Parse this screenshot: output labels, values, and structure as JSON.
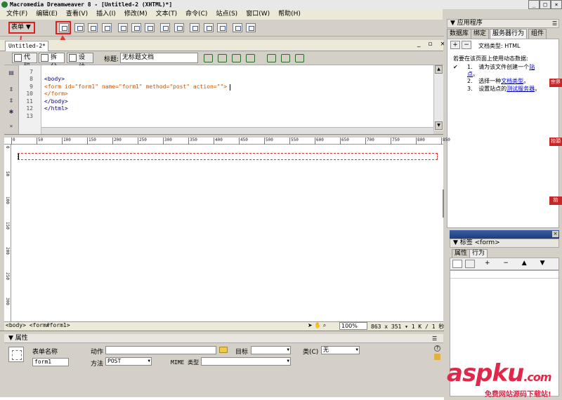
{
  "window": {
    "title": "Macromedia Dreamweaver 8 - [Untitled-2 (XHTML)*]",
    "controls": [
      "_",
      "□",
      "×"
    ]
  },
  "menubar": [
    "文件(F)",
    "编辑(E)",
    "查看(V)",
    "插入(I)",
    "修改(M)",
    "文本(T)",
    "命令(C)",
    "站点(S)",
    "窗口(W)",
    "帮助(H)"
  ],
  "insert_bar": {
    "category": "表单 ▼"
  },
  "doc": {
    "tab": "Untitled-2*",
    "window_controls": "_ ▫ ×",
    "views": {
      "code": "代码",
      "split": "拆分",
      "design": "设计"
    },
    "title_label": "标题:",
    "title_value": "无标题文档"
  },
  "code": {
    "line_numbers": [
      "7",
      "8",
      "9",
      "10",
      "11",
      "12",
      "13"
    ],
    "lines": [
      "",
      "<body>",
      "<form id=\"form1\" name=\"form1\" method=\"post\" action=\"\">",
      "</form>",
      "</body>",
      "</html>",
      ""
    ]
  },
  "ruler": {
    "h_labels": [
      "0",
      "50",
      "100",
      "150",
      "200",
      "250",
      "300",
      "350",
      "400",
      "450",
      "500",
      "550",
      "600",
      "650",
      "700",
      "750",
      "800",
      "850"
    ],
    "v_labels": [
      "0",
      "50",
      "100",
      "150",
      "200",
      "250",
      "300"
    ]
  },
  "status": {
    "tags": "<body> <form#form1>",
    "zoom": "100%",
    "size": "863 x 351 ▾ 1 K / 1 秒"
  },
  "properties": {
    "header": "▼ 属性",
    "form_name_label": "表单名称",
    "form_name_value": "form1",
    "action_label": "动作",
    "action_value": "",
    "target_label": "目标",
    "target_value": "",
    "class_label": "类(C)",
    "class_value": "无",
    "method_label": "方法",
    "method_value": "POST",
    "enctype_label": "MIME 类型",
    "enctype_value": ""
  },
  "app_panel": {
    "header": "▼ 应用程序",
    "tabs": [
      "数据库",
      "绑定",
      "服务器行为",
      "组件"
    ],
    "doctype": "文档类型: HTML",
    "intro": "若要在该页面上使用动态数据:",
    "steps": [
      {
        "num": "1.",
        "pre": "请为该文件创建一个",
        "link": "站点",
        "post": "。"
      },
      {
        "num": "2.",
        "pre": "选择一种",
        "link": "文档类型",
        "post": "。"
      },
      {
        "num": "3.",
        "pre": "设置站点的",
        "link": "测试服务器",
        "post": "。"
      }
    ]
  },
  "tag_panel": {
    "header": "▼ 标签 <form>",
    "tabs": [
      "属性",
      "行为"
    ]
  },
  "side_bands": [
    "宗界",
    "抬頭",
    "抬"
  ],
  "watermark": {
    "main": "aspku",
    "domain": ".com",
    "sub": "免费网站源码下载站!"
  },
  "colors": {
    "highlight": "#e02020",
    "watermark": "#e0284a",
    "link": "#0000cc"
  }
}
